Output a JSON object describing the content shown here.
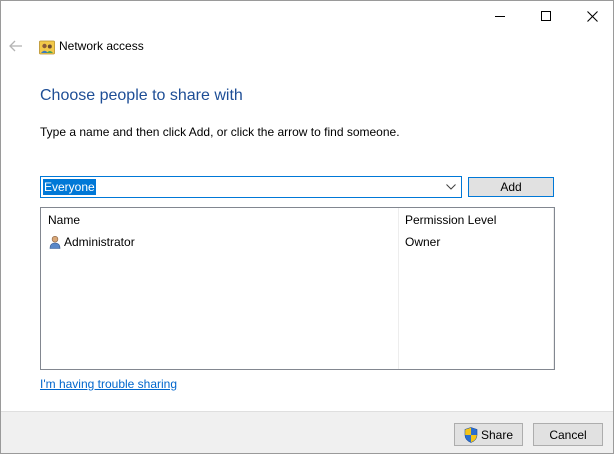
{
  "window": {
    "title": "Network access",
    "controls": {
      "minimize": "minimize-icon",
      "maximize": "maximize-icon",
      "close": "close-icon"
    }
  },
  "nav": {
    "back_icon": "back-arrow-icon",
    "app_icon": "network-people-icon"
  },
  "main": {
    "heading": "Choose people to share with",
    "instruction": "Type a name and then click Add, or click the arrow to find someone.",
    "combo": {
      "value": "Everyone",
      "arrow_icon": "chevron-down-icon"
    },
    "add_label": "Add",
    "list": {
      "columns": [
        "Name",
        "Permission Level"
      ],
      "rows": [
        {
          "name": "Administrator",
          "permission": "Owner",
          "icon": "user-icon"
        }
      ]
    },
    "trouble_link": "I'm having trouble sharing"
  },
  "footer": {
    "share_label": "Share",
    "share_icon": "uac-shield-icon",
    "cancel_label": "Cancel"
  },
  "colors": {
    "heading": "#1e4e96",
    "accent": "#0078d7",
    "link": "#0066cc",
    "footer_bg": "#f0f0f0"
  }
}
